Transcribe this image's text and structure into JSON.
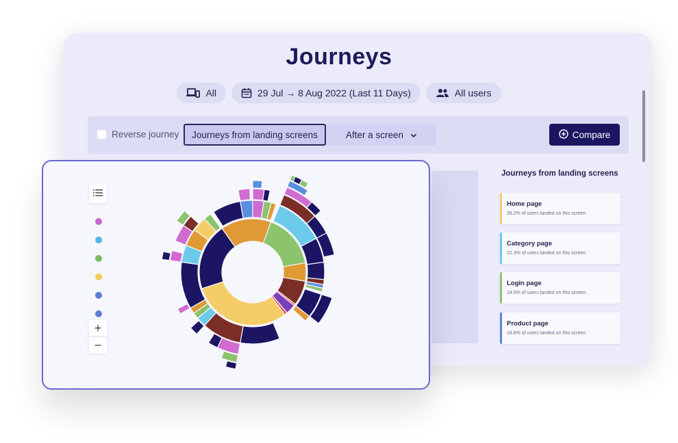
{
  "page": {
    "title": "Journeys"
  },
  "filters": {
    "device": {
      "label": "All",
      "icon": "devices-icon"
    },
    "date_range": {
      "label": "29 Jul → 8 Aug 2022 (Last 11 Days)",
      "icon": "calendar-icon"
    },
    "segment": {
      "label": "All users",
      "icon": "users-icon"
    }
  },
  "toolbar": {
    "reverse_journey_label": "Reverse journey",
    "reverse_journey_checked": false,
    "mode_tabs": [
      {
        "label": "Journeys from landing screens",
        "active": true
      },
      {
        "label": "After a screen",
        "active": false,
        "has_dropdown": true
      }
    ],
    "compare_label": "Compare",
    "compare_icon": "plus-circle-icon"
  },
  "sidebar": {
    "title": "Journeys from landing screens",
    "cards": [
      {
        "name": "Home page",
        "subtitle": "28.2% of users landed on this screen",
        "color": "#f0cf6a"
      },
      {
        "name": "Category page",
        "subtitle": "22.3% of users landed on this screen",
        "color": "#6dcbea"
      },
      {
        "name": "Login page",
        "subtitle": "14.5% of users landed on this screen",
        "color": "#8dc66f"
      },
      {
        "name": "Product page",
        "subtitle": "18.8% of users landed on this screen",
        "color": "#5c86d8"
      }
    ]
  },
  "chart_controls": {
    "list_icon": "list-icon",
    "zoom_in_label": "+",
    "zoom_out_label": "−",
    "legend_dots": [
      "#c966cc",
      "#4fb7ec",
      "#7dbb63",
      "#f2cc55",
      "#5b7fd6",
      "#5b7fd6"
    ]
  },
  "colors": {
    "accent_dark": "#1a1660",
    "front_border": "#6a6ad0"
  },
  "chart_data": {
    "type": "sunburst",
    "title": "",
    "palette": {
      "navy": "#1b1563",
      "orange": "#e09a35",
      "green": "#8cc46d",
      "sky": "#6ccbea",
      "yellow": "#f5cd67",
      "brown": "#7b2e26",
      "pink": "#d06bd1",
      "blue": "#5b8ee0",
      "purple": "#7a3fb8",
      "red": "#e4564a"
    },
    "rings": [
      {
        "level": 1,
        "segments": [
          {
            "from": 0,
            "to": 80,
            "color": "green"
          },
          {
            "from": 80,
            "to": 100,
            "color": "orange"
          },
          {
            "from": 100,
            "to": 127,
            "color": "brown"
          },
          {
            "from": 127,
            "to": 129,
            "color": "red"
          },
          {
            "from": 129,
            "to": 140,
            "color": "purple"
          },
          {
            "from": 140,
            "to": 143,
            "color": "red"
          },
          {
            "from": 143,
            "to": 252,
            "color": "yellow"
          },
          {
            "from": 252,
            "to": 325,
            "color": "navy"
          },
          {
            "from": 325,
            "to": 20,
            "color": "orange"
          }
        ]
      },
      {
        "level": 2,
        "segments": [
          {
            "from": 22,
            "to": 62,
            "color": "sky"
          },
          {
            "from": 62,
            "to": 82,
            "color": "navy"
          },
          {
            "from": 82,
            "to": 96,
            "color": "navy"
          },
          {
            "from": 96,
            "to": 100,
            "color": "brown"
          },
          {
            "from": 100,
            "to": 103,
            "color": "blue"
          },
          {
            "from": 103,
            "to": 106,
            "color": "green"
          },
          {
            "from": 108,
            "to": 128,
            "color": "navy"
          },
          {
            "from": 128,
            "to": 133,
            "color": "orange"
          },
          {
            "from": 158,
            "to": 190,
            "color": "navy"
          },
          {
            "from": 190,
            "to": 222,
            "color": "brown"
          },
          {
            "from": 222,
            "to": 230,
            "color": "sky"
          },
          {
            "from": 230,
            "to": 235,
            "color": "green"
          },
          {
            "from": 235,
            "to": 240,
            "color": "orange"
          },
          {
            "from": 240,
            "to": 278,
            "color": "navy"
          },
          {
            "from": 278,
            "to": 292,
            "color": "sky"
          },
          {
            "from": 292,
            "to": 306,
            "color": "orange"
          },
          {
            "from": 306,
            "to": 318,
            "color": "yellow"
          },
          {
            "from": 318,
            "to": 324,
            "color": "green"
          },
          {
            "from": 327,
            "to": 350,
            "color": "navy"
          },
          {
            "from": 350,
            "to": 360,
            "color": "blue"
          },
          {
            "from": 0,
            "to": 9,
            "color": "pink"
          },
          {
            "from": 9,
            "to": 15,
            "color": "green"
          },
          {
            "from": 15,
            "to": 19,
            "color": "orange"
          }
        ]
      },
      {
        "level": 3,
        "segments": [
          {
            "from": 22,
            "to": 48,
            "color": "brown"
          },
          {
            "from": 48,
            "to": 62,
            "color": "navy"
          },
          {
            "from": 62,
            "to": 78,
            "color": "navy"
          },
          {
            "from": 108,
            "to": 128,
            "color": "navy"
          },
          {
            "from": 190,
            "to": 205,
            "color": "pink"
          },
          {
            "from": 205,
            "to": 212,
            "color": "navy"
          },
          {
            "from": 222,
            "to": 228,
            "color": "navy"
          },
          {
            "from": 240,
            "to": 244,
            "color": "pink"
          },
          {
            "from": 278,
            "to": 285,
            "color": "pink"
          },
          {
            "from": 292,
            "to": 304,
            "color": "pink"
          },
          {
            "from": 304,
            "to": 312,
            "color": "brown"
          },
          {
            "from": 350,
            "to": 358,
            "color": "pink"
          },
          {
            "from": 0,
            "to": 8,
            "color": "pink"
          },
          {
            "from": 8,
            "to": 12,
            "color": "navy"
          }
        ]
      },
      {
        "level": 4,
        "segments": [
          {
            "from": 22,
            "to": 40,
            "color": "pink"
          },
          {
            "from": 40,
            "to": 48,
            "color": "navy"
          },
          {
            "from": 190,
            "to": 200,
            "color": "green"
          },
          {
            "from": 278,
            "to": 283,
            "color": "navy"
          },
          {
            "from": 304,
            "to": 312,
            "color": "green"
          },
          {
            "from": 0,
            "to": 6,
            "color": "blue"
          }
        ]
      },
      {
        "level": 5,
        "segments": [
          {
            "from": 22,
            "to": 34,
            "color": "blue"
          },
          {
            "from": 190,
            "to": 196,
            "color": "navy"
          }
        ]
      },
      {
        "level": 6,
        "segments": [
          {
            "from": 22,
            "to": 32,
            "color": "green"
          },
          {
            "from": 24,
            "to": 28,
            "color": "navy"
          }
        ]
      }
    ]
  }
}
